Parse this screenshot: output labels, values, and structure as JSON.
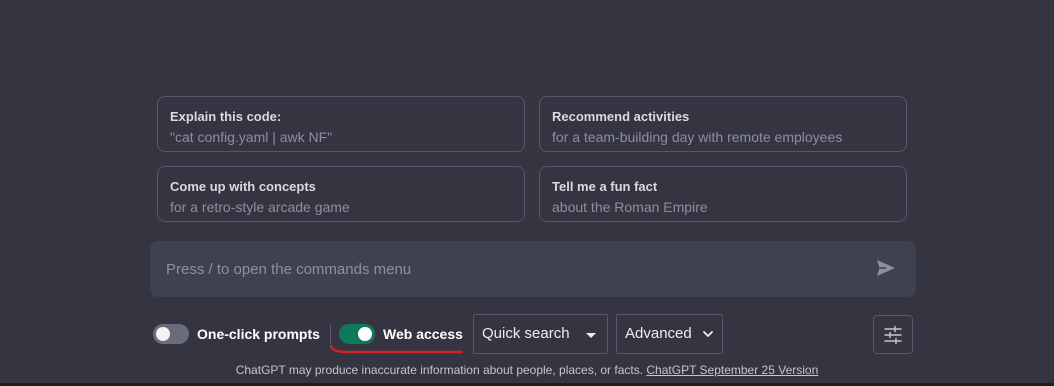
{
  "suggestions": [
    {
      "title": "Explain this code:",
      "subtitle": "\"cat config.yaml | awk NF\""
    },
    {
      "title": "Recommend activities",
      "subtitle": "for a team-building day with remote employees"
    },
    {
      "title": "Come up with concepts",
      "subtitle": "for a retro-style arcade game"
    },
    {
      "title": "Tell me a fun fact",
      "subtitle": "about the Roman Empire"
    }
  ],
  "composer": {
    "placeholder": "Press / to open the commands menu",
    "value": "",
    "send_icon": "send-icon"
  },
  "options": {
    "one_click_prompts": {
      "label": "One-click prompts",
      "enabled": false
    },
    "web_access": {
      "label": "Web access",
      "enabled": true,
      "accent": "#0f7a5a"
    },
    "search_mode": {
      "selected": "Quick search",
      "icon": "caret-down-icon"
    },
    "detail_mode": {
      "selected": "Advanced",
      "icon": "chevron-down-icon"
    },
    "settings_icon": "sliders-icon"
  },
  "footer": {
    "text": "ChatGPT may produce inaccurate information about people, places, or facts. ",
    "link": "ChatGPT September 25 Version"
  },
  "colors": {
    "background": "#343541",
    "composer": "#40414f",
    "annotation": "#d61f1f"
  }
}
